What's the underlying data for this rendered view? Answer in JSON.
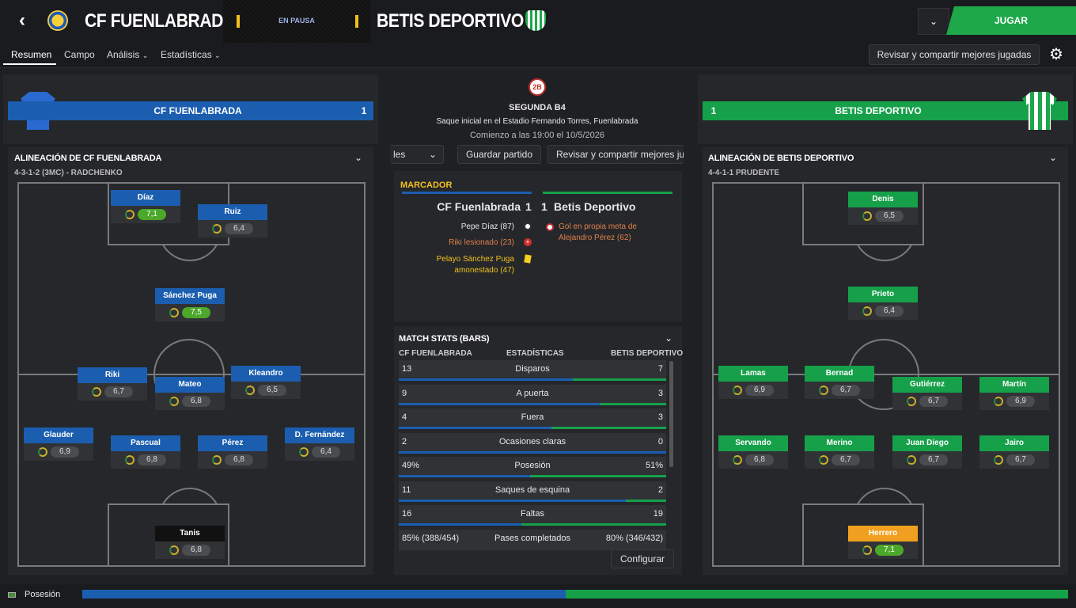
{
  "header": {
    "home_team": "CF FUENLABRADA",
    "away_team": "BETIS DEPORTIVO",
    "status": "EN PAUSA",
    "play_button": "JUGAR"
  },
  "nav": {
    "tabs": [
      "Resumen",
      "Campo",
      "Análisis",
      "Estadísticas"
    ],
    "share_button": "Revisar y compartir mejores jugadas"
  },
  "home_bar": {
    "name": "CF FUENLABRADA",
    "score": "1"
  },
  "away_bar": {
    "name": "BETIS DEPORTIVO",
    "score": "1"
  },
  "center": {
    "competition": "SEGUNDA B4",
    "kickoff": "Saque inicial en el Estadio Fernando Torres, Fuenlabrada",
    "start_time": "Comienzo a las 19:00 el 10/5/2026",
    "dropdown_partial": "les",
    "save_button": "Guardar partido",
    "share_button_partial": "Revisar y compartir mejores ju"
  },
  "scoreboard": {
    "title": "MARCADOR",
    "home": "CF Fuenlabrada",
    "home_score": "1",
    "away_score": "1",
    "away": "Betis Deportivo",
    "home_events": [
      {
        "text": "Pepe Díaz (87)",
        "color": "#e8e8e8"
      },
      {
        "text": "Riki lesionado (23)",
        "color": "#e0804a"
      },
      {
        "text": "Pelayo Sánchez Puga",
        "color": "#f2c01e"
      },
      {
        "text": "amonestado (47)",
        "color": "#f2c01e"
      }
    ],
    "away_events": [
      {
        "text": "Gol en propia meta de",
        "color": "#e0804a"
      },
      {
        "text": "Alejandro Pérez (62)",
        "color": "#e0804a"
      }
    ]
  },
  "stats": {
    "title": "MATCH STATS (BARS)",
    "col_home": "CF FUENLABRADA",
    "col_mid": "ESTADÍSTICAS",
    "col_away": "BETIS DEPORTIVO",
    "rows": [
      {
        "home": "13",
        "label": "Disparos",
        "away": "7",
        "home_share": 0.65
      },
      {
        "home": "9",
        "label": "A puerta",
        "away": "3",
        "home_share": 0.75
      },
      {
        "home": "4",
        "label": "Fuera",
        "away": "3",
        "home_share": 0.57
      },
      {
        "home": "2",
        "label": "Ocasiones claras",
        "away": "0",
        "home_share": 1.0
      },
      {
        "home": "49%",
        "label": "Posesión",
        "away": "51%",
        "home_share": 0.49
      },
      {
        "home": "11",
        "label": "Saques de esquina",
        "away": "2",
        "home_share": 0.85
      },
      {
        "home": "16",
        "label": "Faltas",
        "away": "19",
        "home_share": 0.46
      },
      {
        "home": "85% (388/454)",
        "label": "Pases completados",
        "away": "80% (346/432)",
        "home_share": 0.5
      }
    ],
    "configure": "Configurar"
  },
  "home_lineup": {
    "title": "ALINEACIÓN DE CF FUENLABRADA",
    "formation": "4-3-1-2 (3MC) - RADCHENKO",
    "players": [
      {
        "name": "Díaz",
        "rating": "7,1",
        "good": true
      },
      {
        "name": "Ruiz",
        "rating": "6,4",
        "good": false
      },
      {
        "name": "Sánchez Puga",
        "rating": "7,5",
        "good": true
      },
      {
        "name": "Riki",
        "rating": "6,7",
        "good": false
      },
      {
        "name": "Mateo",
        "rating": "6,8",
        "good": false
      },
      {
        "name": "Kleandro",
        "rating": "6,5",
        "good": false
      },
      {
        "name": "Glauder",
        "rating": "6,9",
        "good": false
      },
      {
        "name": "Pascual",
        "rating": "6,8",
        "good": false
      },
      {
        "name": "Pérez",
        "rating": "6,8",
        "good": false
      },
      {
        "name": "D. Fernández",
        "rating": "6,4",
        "good": false
      },
      {
        "name": "Tanis",
        "rating": "6,8",
        "good": false
      }
    ]
  },
  "away_lineup": {
    "title": "ALINEACIÓN DE BETIS DEPORTIVO",
    "formation": "4-4-1-1 PRUDENTE",
    "players": [
      {
        "name": "Denis",
        "rating": "6,5",
        "good": false
      },
      {
        "name": "Prieto",
        "rating": "6,4",
        "good": false
      },
      {
        "name": "Lamas",
        "rating": "6,9",
        "good": false
      },
      {
        "name": "Bernad",
        "rating": "6,7",
        "good": false
      },
      {
        "name": "Gutiérrez",
        "rating": "6,7",
        "good": false
      },
      {
        "name": "Martín",
        "rating": "6,9",
        "good": false
      },
      {
        "name": "Servando",
        "rating": "6,8",
        "good": false
      },
      {
        "name": "Merino",
        "rating": "6,7",
        "good": false
      },
      {
        "name": "Juan Diego",
        "rating": "6,7",
        "good": false
      },
      {
        "name": "Jairo",
        "rating": "6,7",
        "good": false
      },
      {
        "name": "Herrero",
        "rating": "7,1",
        "good": true
      }
    ]
  },
  "possession": {
    "label": "Posesión",
    "home_share": 0.49
  },
  "colors": {
    "home": "#1b5eb0",
    "away": "#16a04a",
    "keeper_home": "#111111",
    "keeper_away": "#f0a020",
    "accent": "#1ea84a"
  }
}
